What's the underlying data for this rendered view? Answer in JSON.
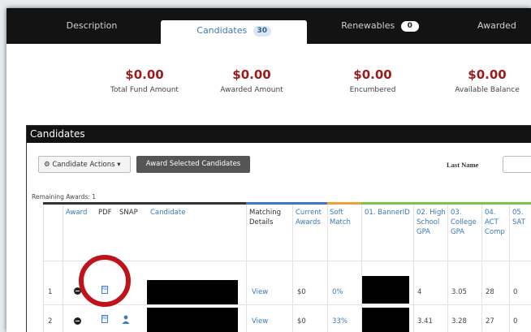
{
  "tabs": [
    {
      "label": "Description"
    },
    {
      "label": "Candidates",
      "badge": "30"
    },
    {
      "label": "Renewables",
      "badge": "0"
    },
    {
      "label": "Awarded"
    }
  ],
  "funds": [
    {
      "value": "$0.00",
      "label": "Total Fund Amount"
    },
    {
      "value": "$0.00",
      "label": "Awarded Amount"
    },
    {
      "value": "$0.00",
      "label": "Encumbered"
    },
    {
      "value": "$0.00",
      "label": "Available Balance"
    }
  ],
  "panel": {
    "title": "Candidates",
    "actions_label": "Candidate Actions",
    "award_selected_label": "Award Selected Candidates",
    "filter_label": "Last Name",
    "remaining": "Remaining Awards: 1"
  },
  "columns": {
    "award": "Award",
    "pdf": "PDF",
    "snap": "SNAP",
    "candidate": "Candidate",
    "matching": "Matching Details",
    "current": "Current Awards",
    "soft": "Soft Match",
    "c01": "01. BannerID",
    "c02": "02. High School GPA",
    "c03": "03. College GPA",
    "c04": "04. ACT Comp",
    "c05": "05. SAT"
  },
  "rows": [
    {
      "index": "1",
      "matching": "View",
      "current": "$0",
      "soft": "0%",
      "hs_gpa": "4",
      "college_gpa": "3.05",
      "act": "28",
      "sat": "0"
    },
    {
      "index": "2",
      "matching": "View",
      "current": "$0",
      "soft": "33%",
      "hs_gpa": "3.41",
      "college_gpa": "3.28",
      "act": "27",
      "sat": "0"
    }
  ],
  "colors": {
    "accent": "#3b78b5",
    "money": "#9b1b1b",
    "highlight": "#c0121a"
  }
}
